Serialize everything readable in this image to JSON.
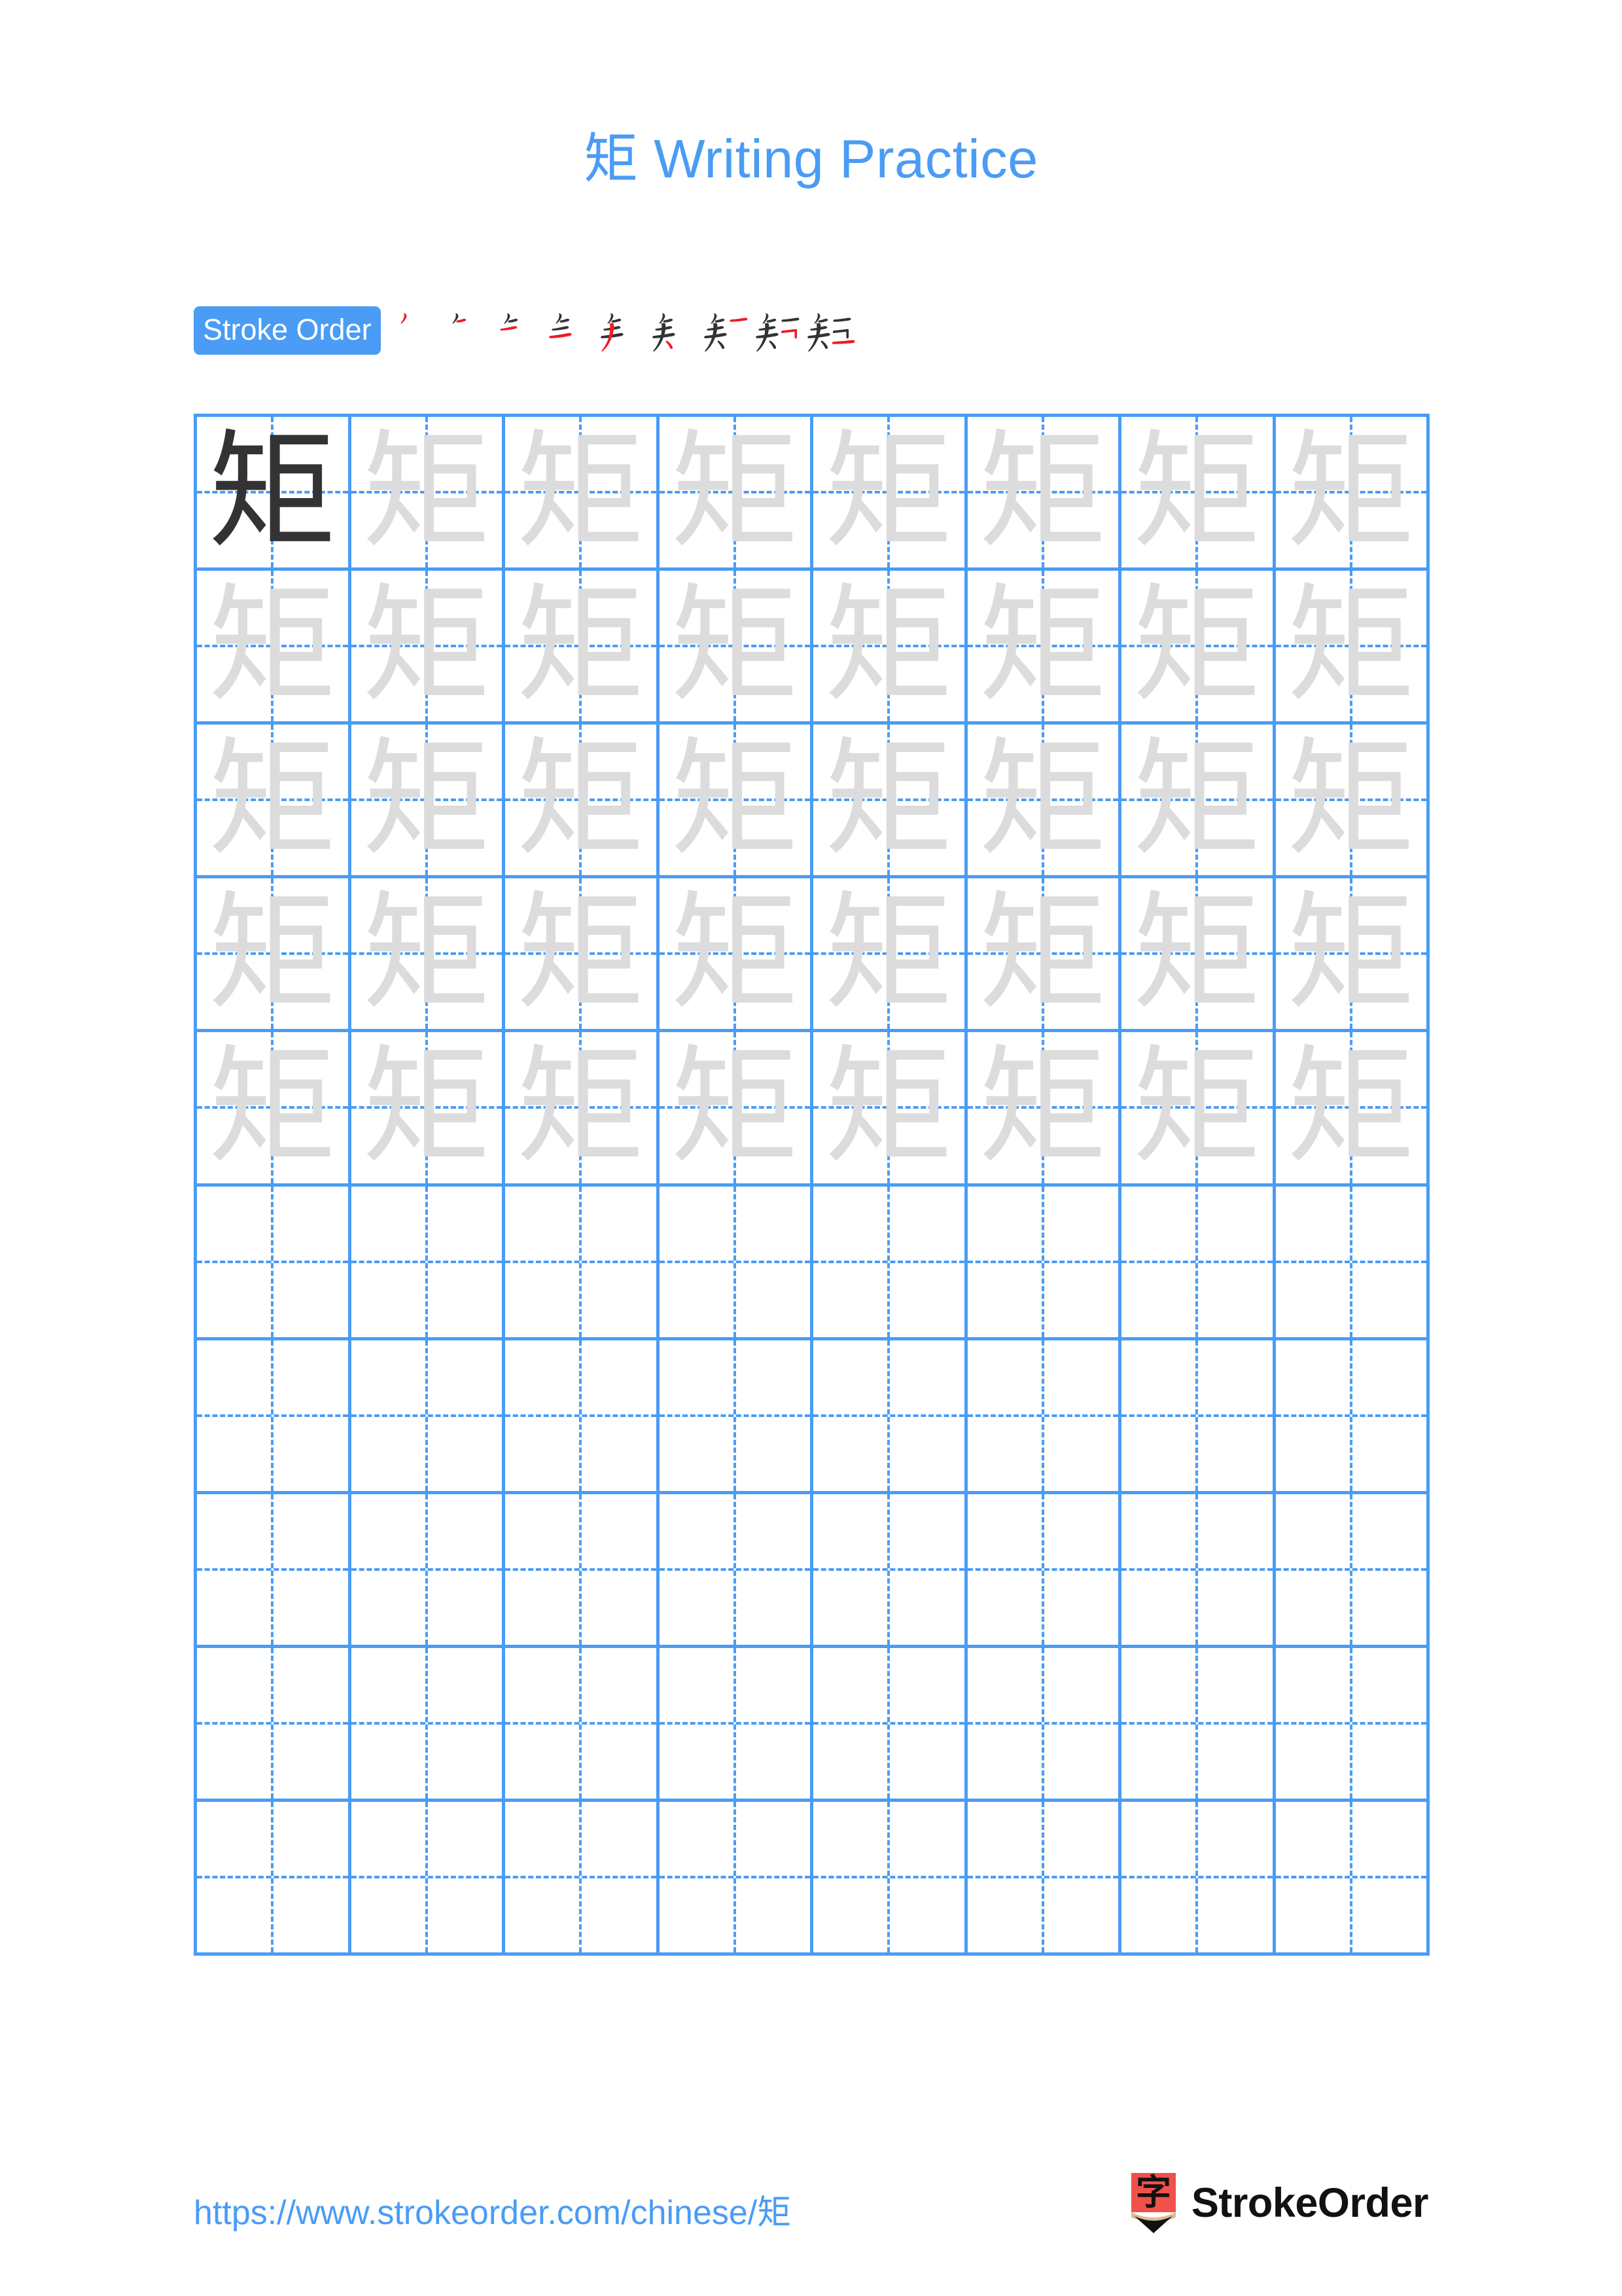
{
  "page": {
    "title": "矩 Writing Practice",
    "character": "矩",
    "accent_color": "#4a9cf5",
    "grid_line_color": "#4a9cf5",
    "example_char_color": "#333333",
    "trace_char_color": "#dcdcdc",
    "background_color": "#ffffff"
  },
  "stroke_order": {
    "badge_label": "Stroke Order",
    "stroke_count": 9,
    "new_stroke_color": "#ee1c25",
    "existing_stroke_color": "#333333",
    "steps": [
      {
        "index": 1,
        "strokes_shown": 1
      },
      {
        "index": 2,
        "strokes_shown": 2
      },
      {
        "index": 3,
        "strokes_shown": 3
      },
      {
        "index": 4,
        "strokes_shown": 4
      },
      {
        "index": 5,
        "strokes_shown": 5
      },
      {
        "index": 6,
        "strokes_shown": 6
      },
      {
        "index": 7,
        "strokes_shown": 7
      },
      {
        "index": 8,
        "strokes_shown": 8
      },
      {
        "index": 9,
        "strokes_shown": 9
      }
    ]
  },
  "practice_grid": {
    "columns": 8,
    "rows": 10,
    "cells": [
      [
        "example",
        "trace",
        "trace",
        "trace",
        "trace",
        "trace",
        "trace",
        "trace"
      ],
      [
        "trace",
        "trace",
        "trace",
        "trace",
        "trace",
        "trace",
        "trace",
        "trace"
      ],
      [
        "trace",
        "trace",
        "trace",
        "trace",
        "trace",
        "trace",
        "trace",
        "trace"
      ],
      [
        "trace",
        "trace",
        "trace",
        "trace",
        "trace",
        "trace",
        "trace",
        "trace"
      ],
      [
        "trace",
        "trace",
        "trace",
        "trace",
        "trace",
        "trace",
        "trace",
        "trace"
      ],
      [
        "empty",
        "empty",
        "empty",
        "empty",
        "empty",
        "empty",
        "empty",
        "empty"
      ],
      [
        "empty",
        "empty",
        "empty",
        "empty",
        "empty",
        "empty",
        "empty",
        "empty"
      ],
      [
        "empty",
        "empty",
        "empty",
        "empty",
        "empty",
        "empty",
        "empty",
        "empty"
      ],
      [
        "empty",
        "empty",
        "empty",
        "empty",
        "empty",
        "empty",
        "empty",
        "empty"
      ],
      [
        "empty",
        "empty",
        "empty",
        "empty",
        "empty",
        "empty",
        "empty",
        "empty"
      ]
    ]
  },
  "footer": {
    "url": "https://www.strokeorder.com/chinese/矩",
    "brand_name": "StrokeOrder",
    "logo_icon": "pencil-zi-icon",
    "logo_char": "字",
    "logo_body_color": "#f2504b",
    "logo_wood_color": "#dcbc92",
    "logo_tip_color": "#111111"
  }
}
